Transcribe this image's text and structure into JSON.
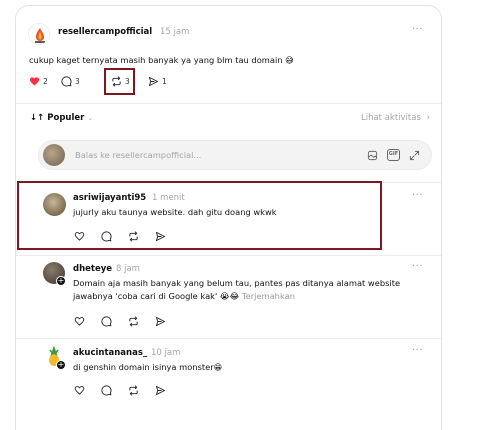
{
  "post": {
    "username": "resellercampofficial",
    "time": "15 jam",
    "text": "cukup kaget ternyata masih banyak ya yang blm tau domain 😅",
    "likes": "2",
    "comments": "3",
    "reposts": "3",
    "shares": "1"
  },
  "sort": {
    "label": "Populer",
    "activity_label": "Lihat aktivitas"
  },
  "reply_box": {
    "placeholder": "Balas ke resellercampofficial..."
  },
  "replies": [
    {
      "username": "asriwijayanti95",
      "time": "1 menit",
      "text": "jujurly aku taunya website. dah gitu doang wkwk"
    },
    {
      "username": "dheteye",
      "time": "8 jam",
      "text_line1": "Domain aja masih banyak yang belum tau, pantes pas ditanya alamat website",
      "text_line2": "jawabnya 'coba cari di Google kak' 😭😂",
      "translate": "Terjemahkan"
    },
    {
      "username": "akucintananas_",
      "time": "10 jam",
      "text": "di genshin domain isinya monster😁"
    }
  ],
  "colors": {
    "like_red": "#ff3040",
    "highlight": "#7a1a20",
    "muted": "#a5a5a5"
  }
}
